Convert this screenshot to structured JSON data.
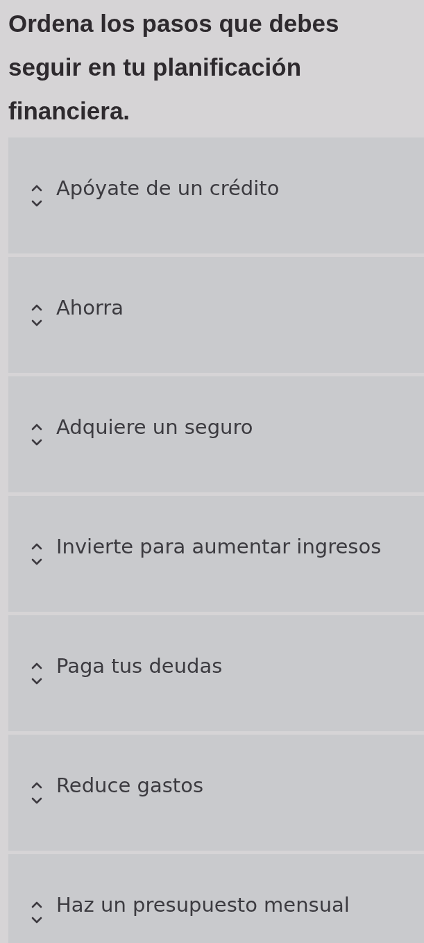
{
  "question": {
    "text": "Ordena los pasos que debes seguir en tu planificación financiera."
  },
  "steps": [
    {
      "label": "Apóyate de un crédito"
    },
    {
      "label": "Ahorra"
    },
    {
      "label": "Adquiere un seguro"
    },
    {
      "label": "Invierte para aumentar ingresos"
    },
    {
      "label": "Paga tus deudas"
    },
    {
      "label": "Reduce gastos"
    },
    {
      "label": "Haz un presupuesto mensual"
    }
  ]
}
